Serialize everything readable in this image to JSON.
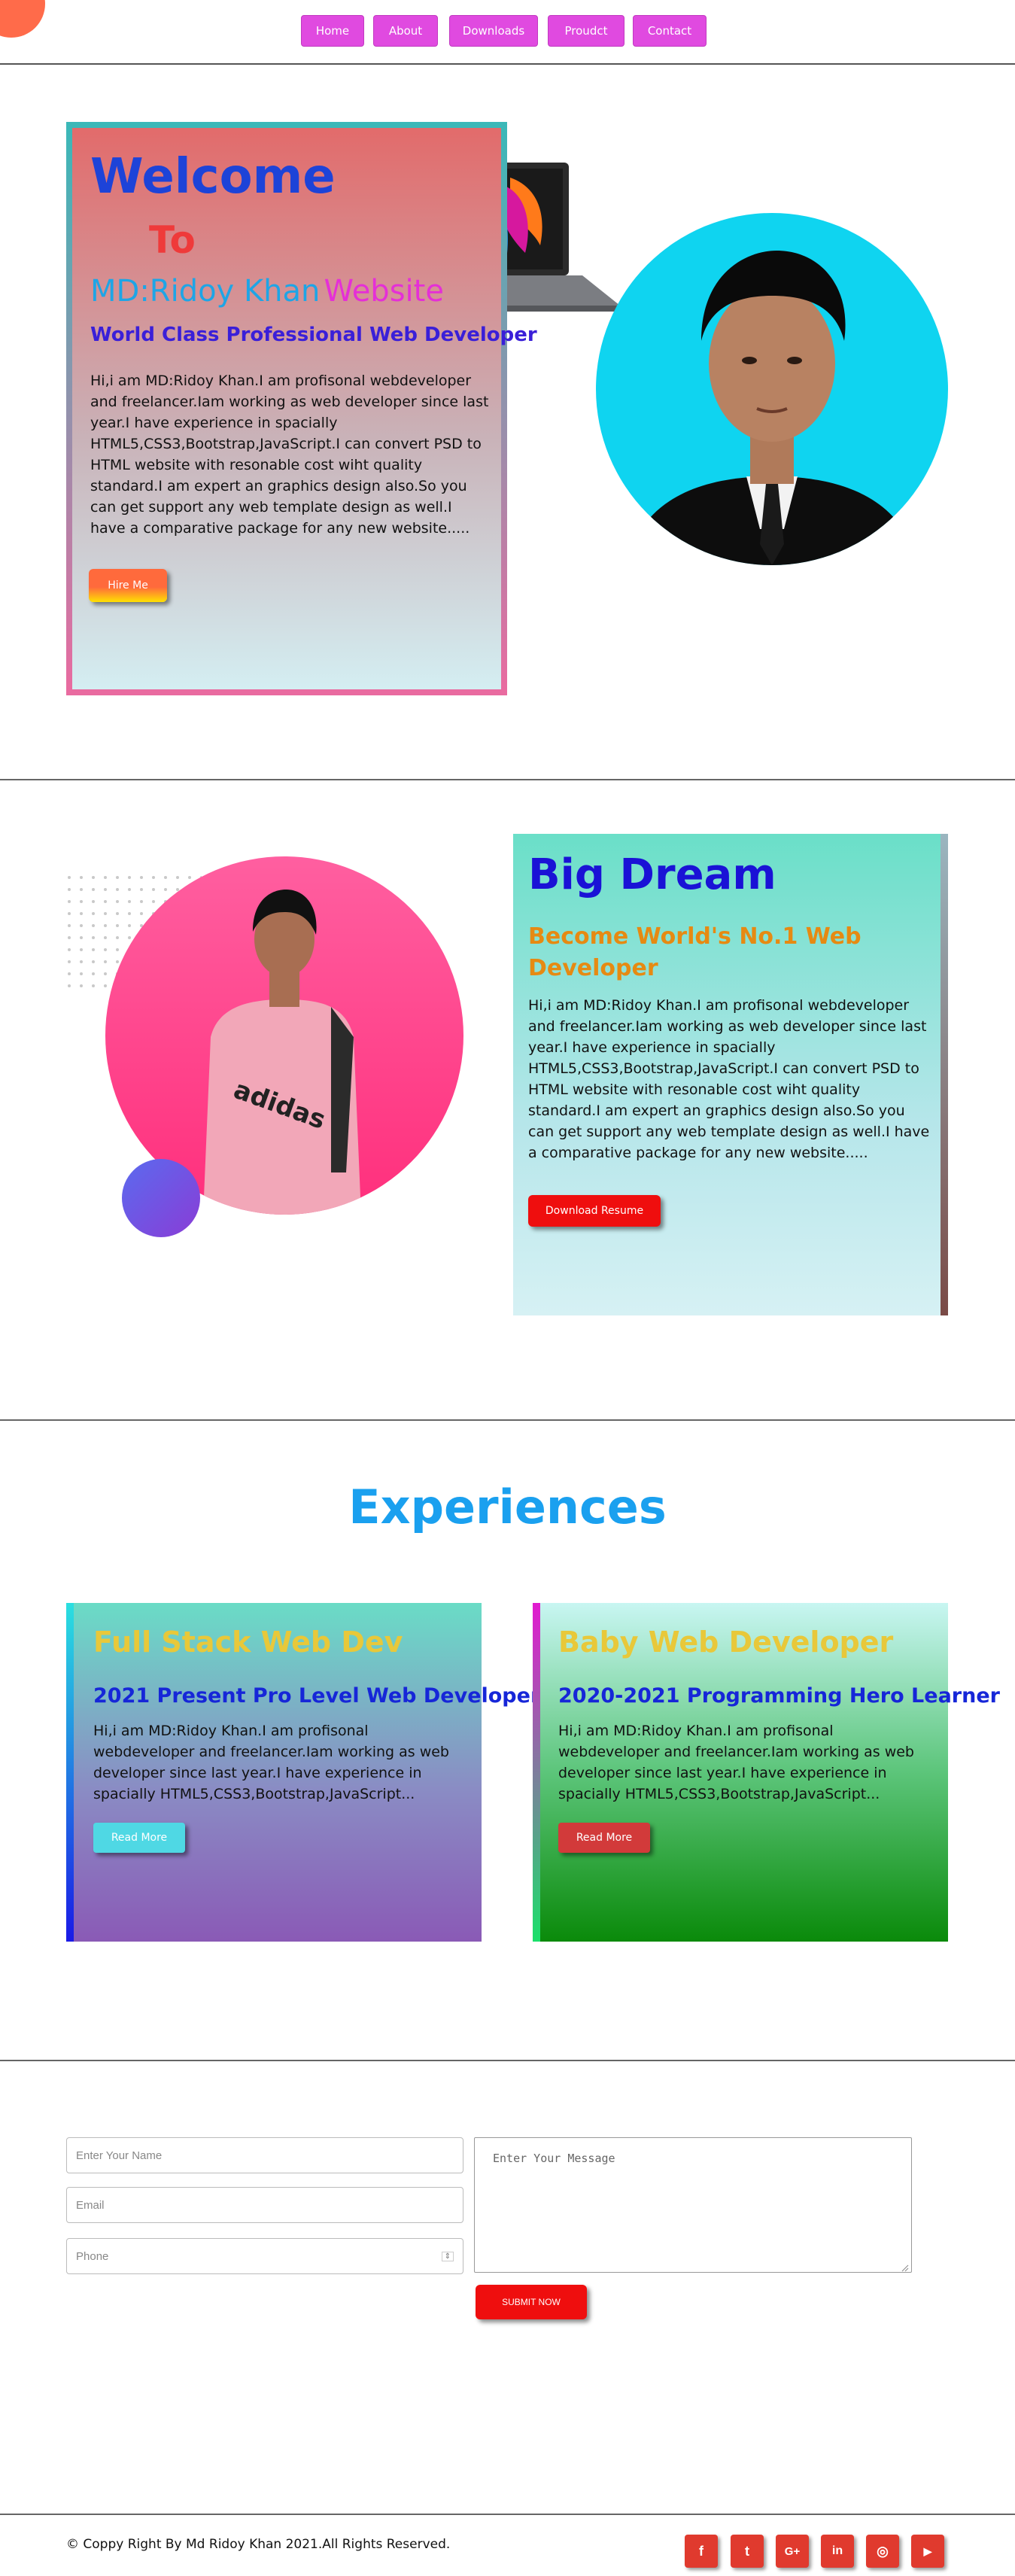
{
  "nav": {
    "items": [
      "Home",
      "About",
      "Downloads",
      "Proudct",
      "Contact"
    ]
  },
  "hero": {
    "welcome": "Welcome",
    "to": "To",
    "name_part1": "MD:Ridoy Khan",
    "name_part2": "Website",
    "tagline": "World Class Professional Web Developer",
    "paragraph": "Hi,i am MD:Ridoy Khan.I am profisonal webdeveloper and freelancer.Iam working as web developer since last year.I have experience in spacially HTML5,CSS3,Bootstrap,JavaScript.I can convert PSD to HTML website with resonable cost wiht quality standard.I am expert an graphics design also.So you can get support any web template design as well.I have a comparative package for any new website.....",
    "hire_button": "Hire Me"
  },
  "dream": {
    "title": "Big Dream",
    "subtitle": "Become World's No.1 Web Developer",
    "paragraph": "Hi,i am MD:Ridoy Khan.I am profisonal webdeveloper and freelancer.Iam working as web developer since last year.I have experience in spacially HTML5,CSS3,Bootstrap,JavaScript.I can convert PSD to HTML website with resonable cost wiht quality standard.I am expert an graphics design also.So you can get support any web template design as well.I have a comparative package for any new website.....",
    "download_button": "Download Resume"
  },
  "experiences": {
    "title": "Experiences",
    "cards": [
      {
        "heading": "Full Stack Web Dev",
        "subheading": "2021 Present Pro Level Web Developer",
        "text": "Hi,i am MD:Ridoy Khan.I am profisonal webdeveloper and freelancer.Iam working as web developer since last year.I have experience in spacially HTML5,CSS3,Bootstrap,JavaScript...",
        "button": "Read More"
      },
      {
        "heading": "Baby Web Developer",
        "subheading": "2020-2021 Programming Hero Learner",
        "text": "Hi,i am MD:Ridoy Khan.I am profisonal webdeveloper and freelancer.Iam working as web developer since last year.I have experience in spacially HTML5,CSS3,Bootstrap,JavaScript...",
        "button": "Read More"
      }
    ]
  },
  "contact_form": {
    "name_placeholder": "Enter Your Name",
    "email_placeholder": "Email",
    "phone_placeholder": "Phone",
    "message_placeholder": "Enter Your Message",
    "submit": "SUBMIT NOW"
  },
  "footer": {
    "copyright": "© Coppy Right By Md Ridoy Khan 2021.All Rights Reserved.",
    "social_icons": [
      "facebook-icon",
      "twitter-icon",
      "google-plus-icon",
      "linkedin-icon",
      "instagram-icon",
      "youtube-icon"
    ],
    "social_glyphs": [
      "f",
      "t",
      "G+",
      "in",
      "◎",
      "▶"
    ]
  },
  "colors": {
    "nav_button": "#e04ae0",
    "accent_red": "#ef0e0e",
    "heading_blue": "#1aa0ef"
  }
}
